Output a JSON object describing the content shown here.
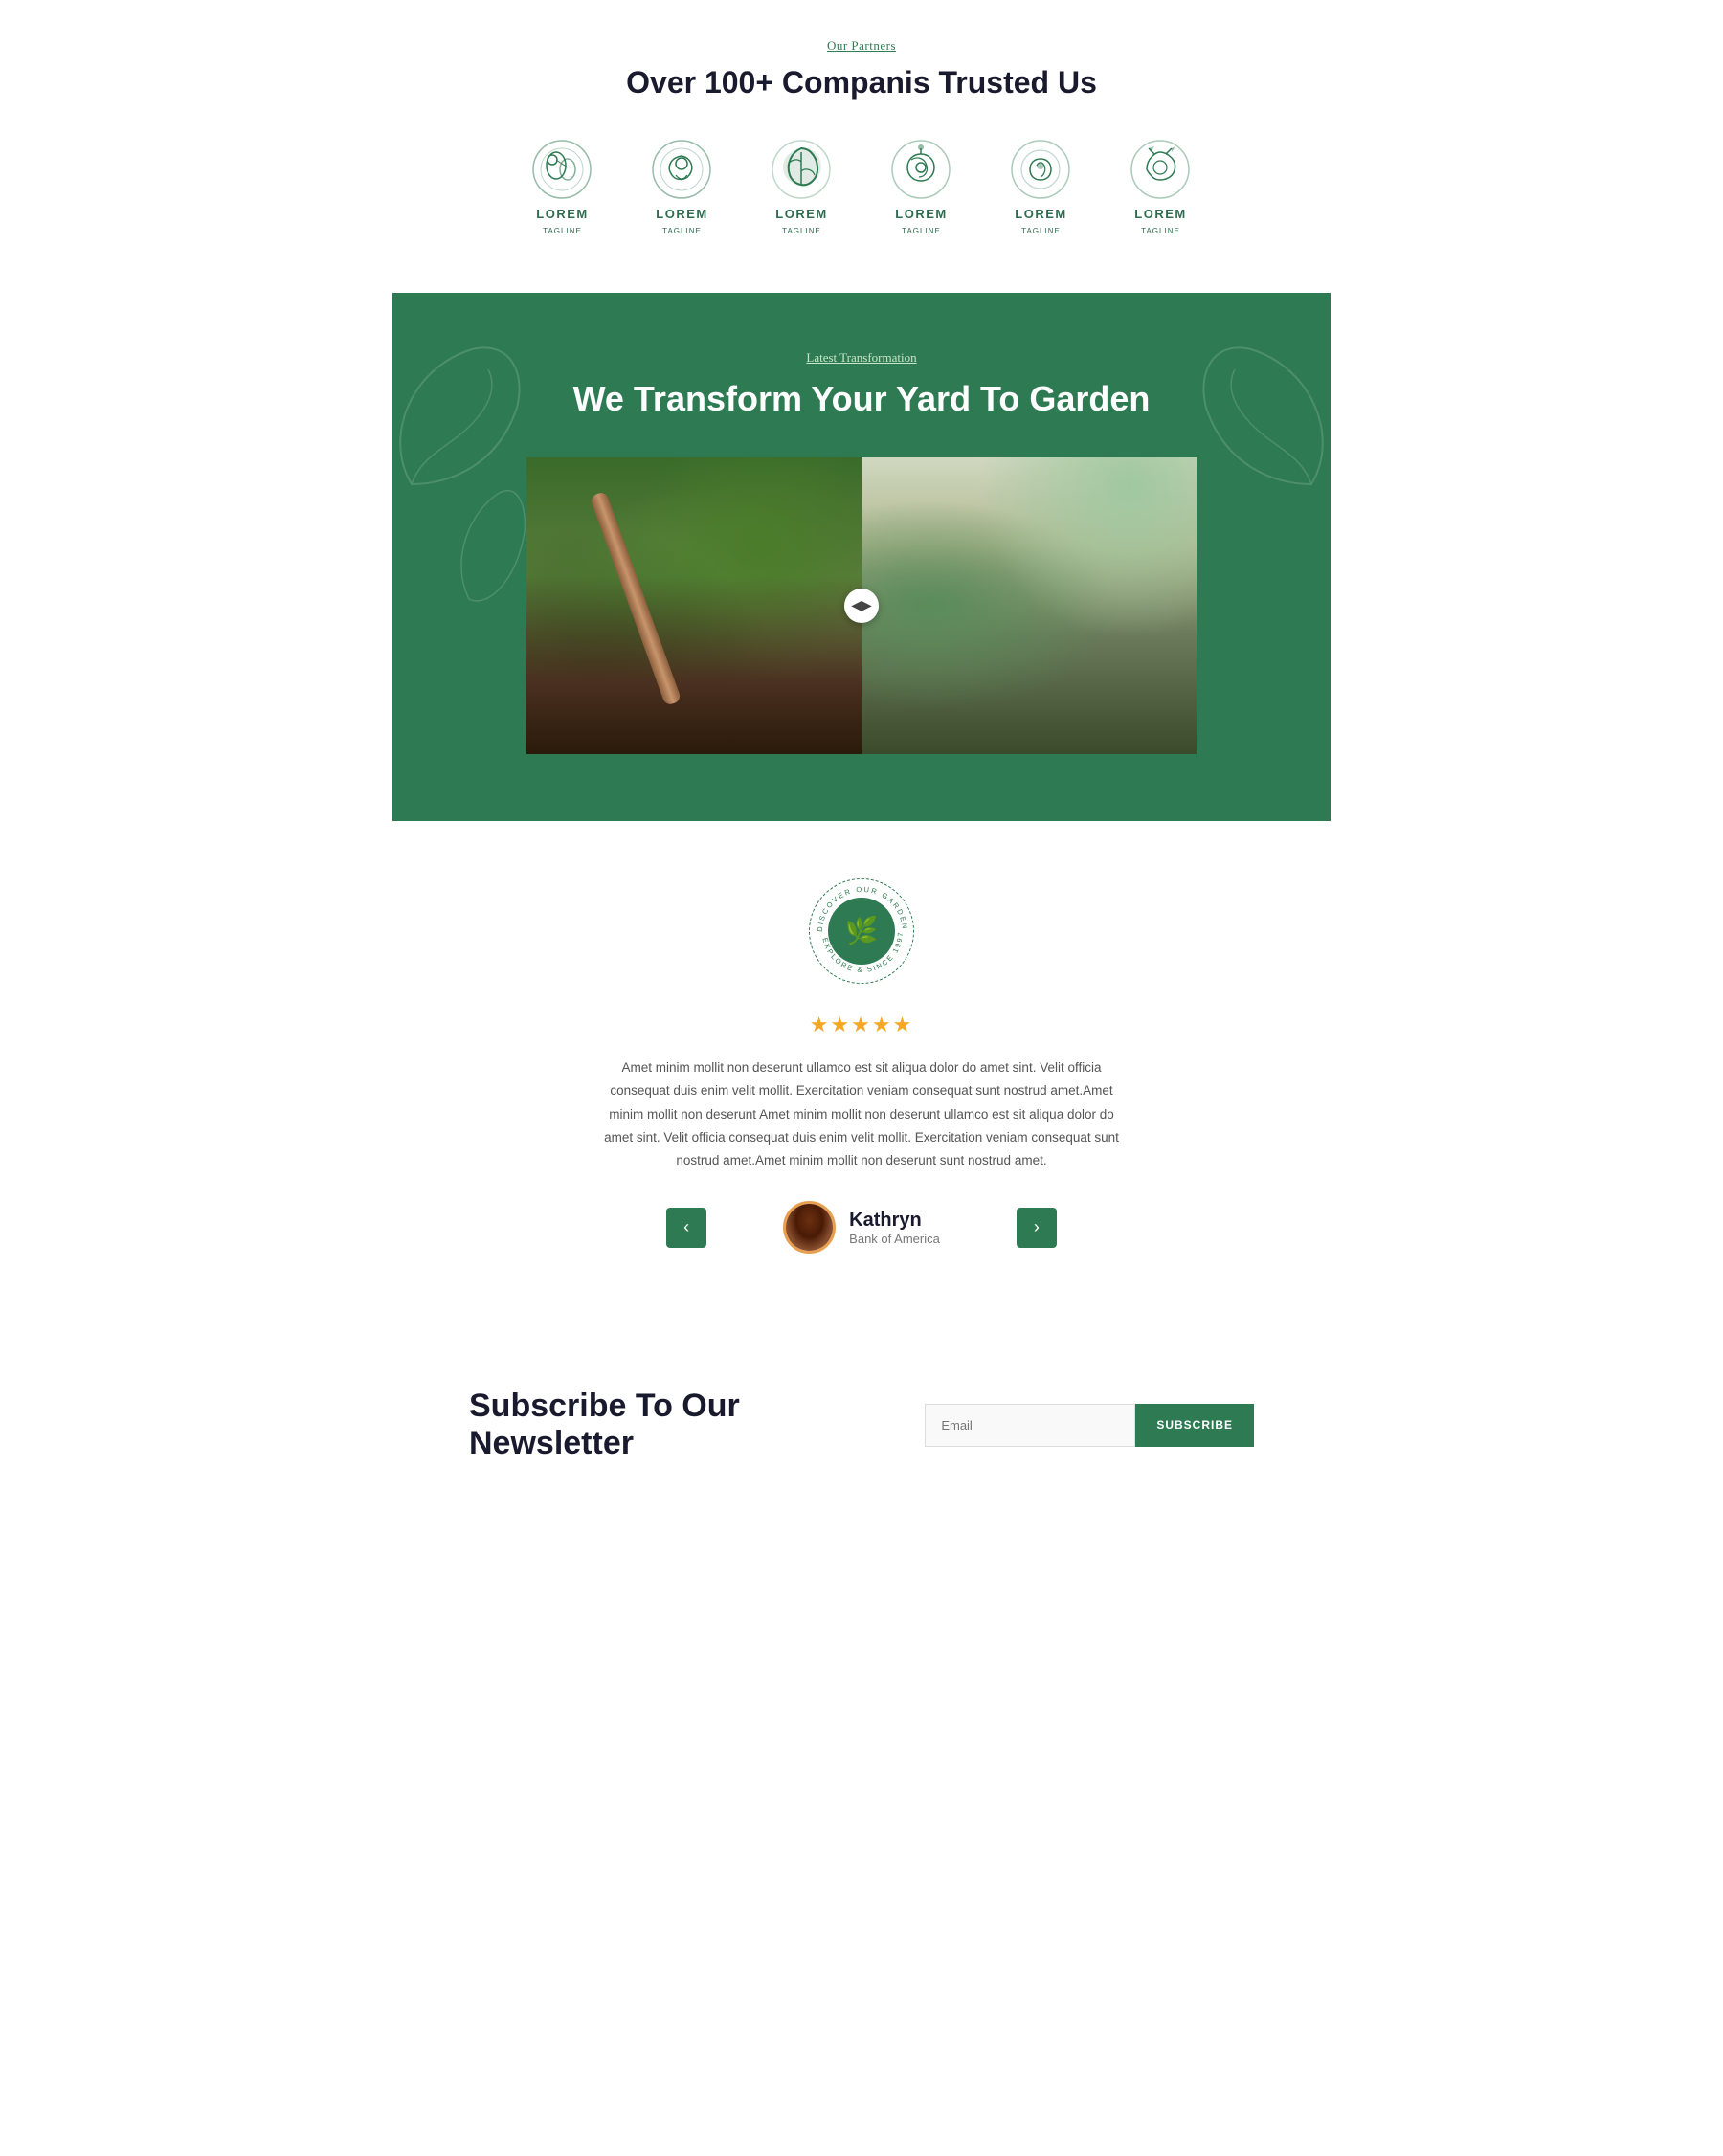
{
  "partners": {
    "label": "Our Partners",
    "title": "Over 100+ Companis Trusted Us",
    "logos": [
      {
        "id": 1,
        "name": "LOREM",
        "tagline": "TAGLINE"
      },
      {
        "id": 2,
        "name": "LOREM",
        "tagline": "TAGLINE"
      },
      {
        "id": 3,
        "name": "LOREM",
        "tagline": "TAGLINE"
      },
      {
        "id": 4,
        "name": "LOREM",
        "tagline": "TAGLINE"
      },
      {
        "id": 5,
        "name": "LOREM",
        "tagline": "TAGLINE"
      },
      {
        "id": 6,
        "name": "LOREM",
        "tagline": "TAGLINE"
      }
    ]
  },
  "transformation": {
    "label": "Latest Transformation",
    "title": "We Transform Your Yard To Garden",
    "divider_icon": "◀▶"
  },
  "testimonial": {
    "badge_text_top": "DISCOVER OUR GARDEN",
    "badge_text_bottom": "EXPLORE & SINCE 1997.",
    "stars": "★★★★★",
    "text": "Amet minim mollit non deserunt ullamco est sit aliqua dolor do amet sint. Velit officia consequat duis enim velit mollit. Exercitation veniam consequat sunt nostrud amet.Amet minim mollit non deserunt Amet minim mollit non deserunt ullamco est sit aliqua dolor do amet sint. Velit officia consequat duis enim velit mollit. Exercitation veniam consequat sunt nostrud amet.Amet minim mollit non deserunt sunt nostrud amet.",
    "prev_arrow": "‹",
    "next_arrow": "›",
    "author_name": "Kathryn",
    "author_company": "Bank of America"
  },
  "newsletter": {
    "title": "Subscribe To Our Newsletter",
    "input_placeholder": "Email",
    "button_label": "SUBSCRIBE"
  }
}
